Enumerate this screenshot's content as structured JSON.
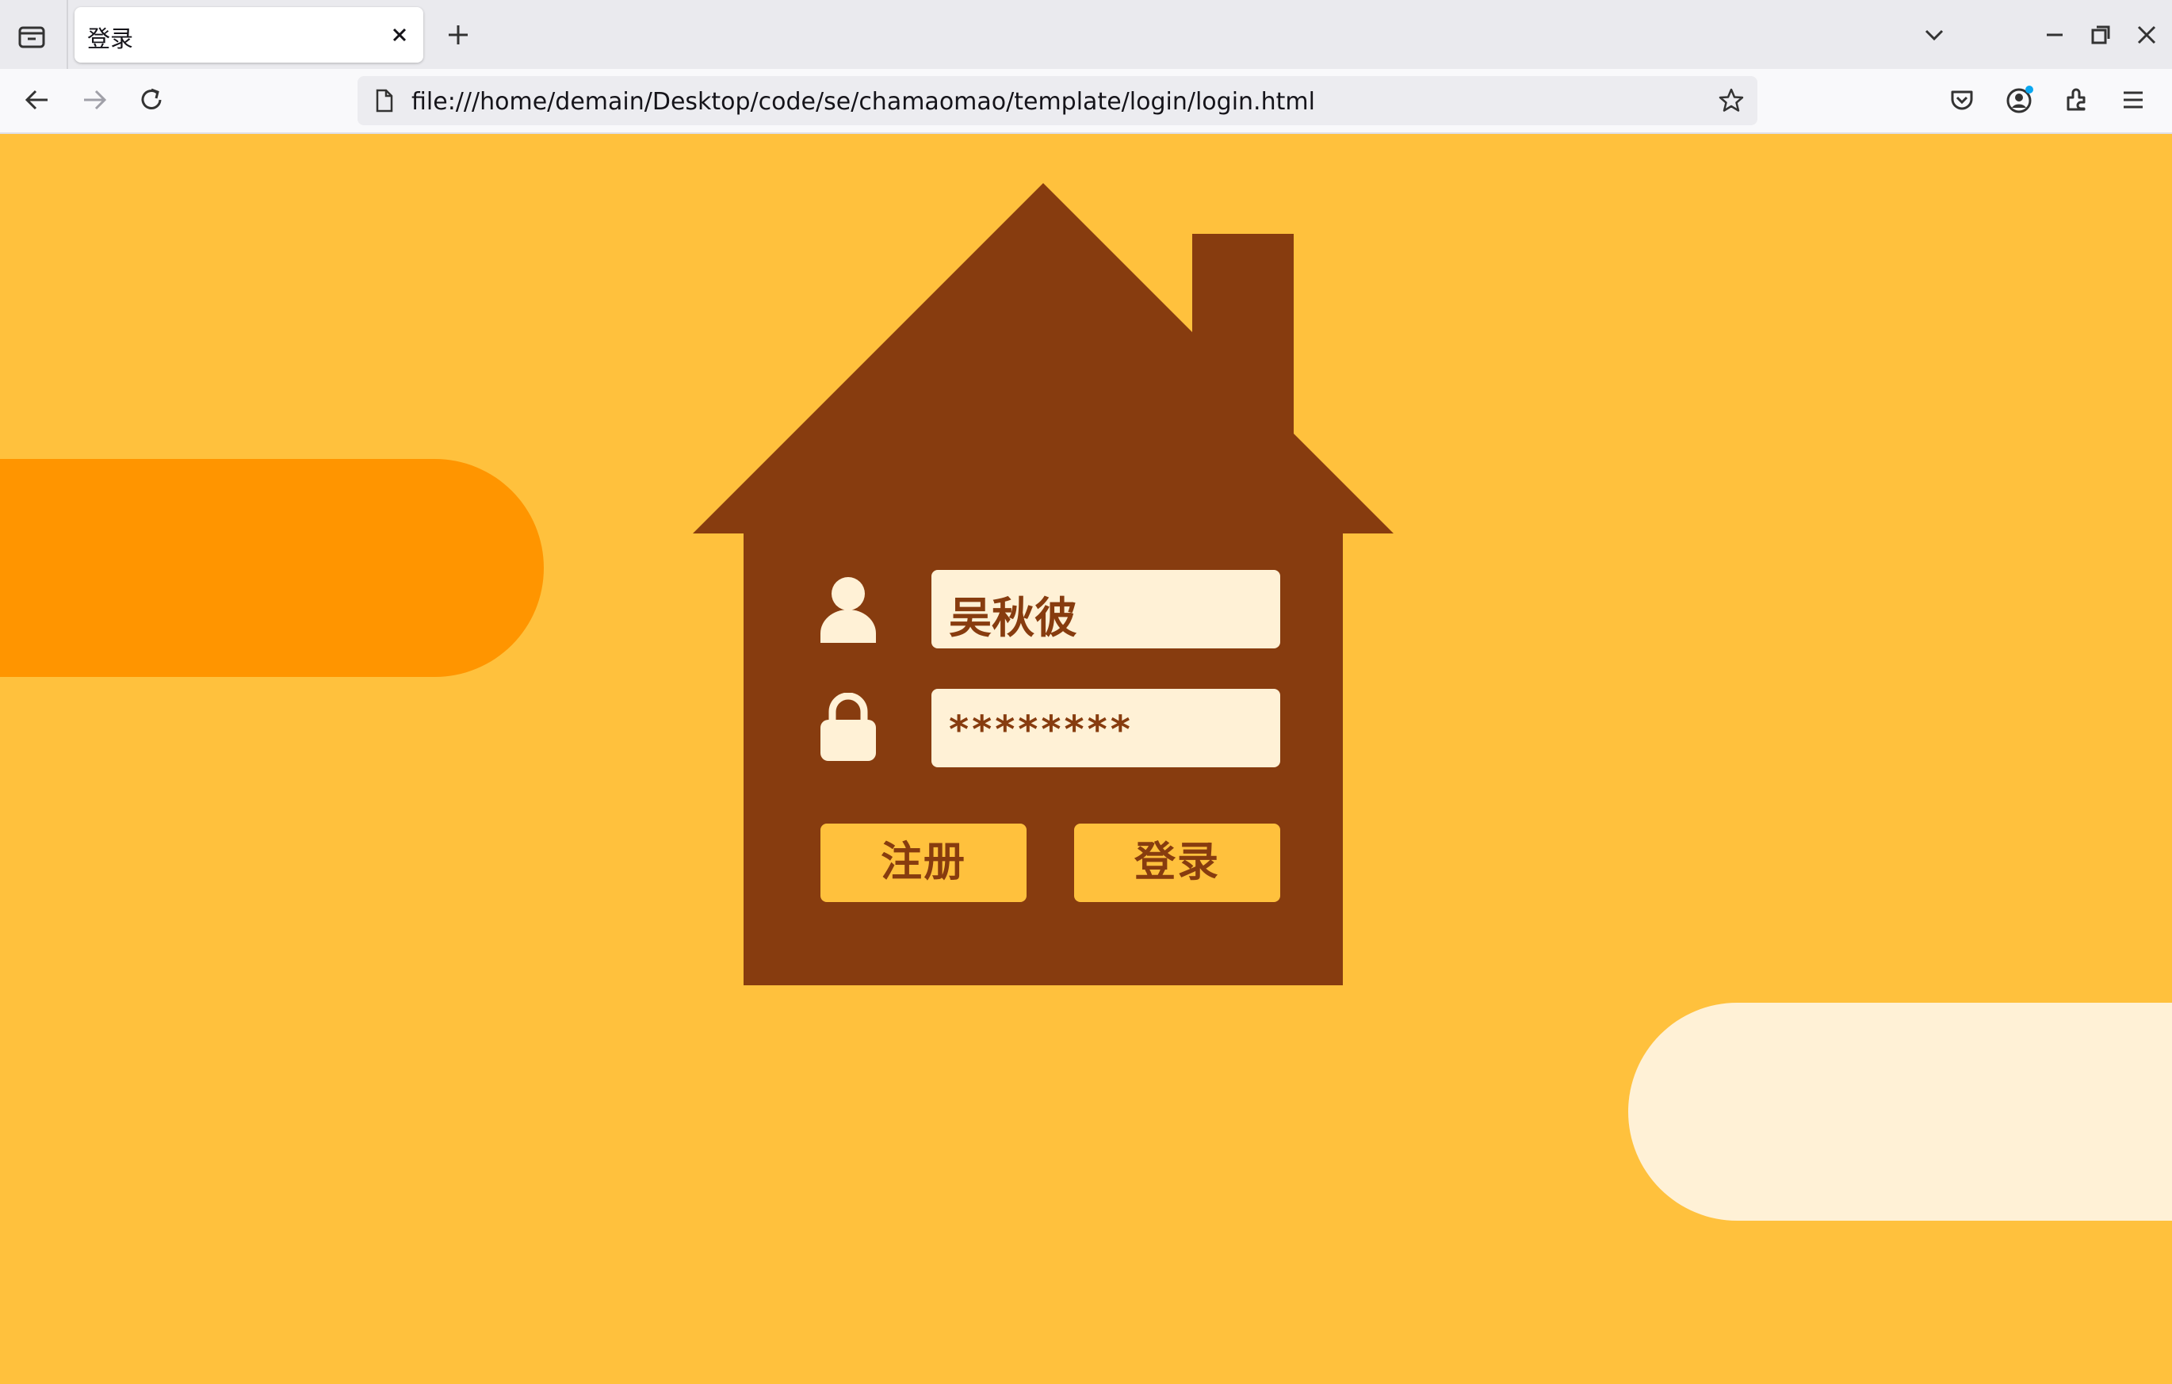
{
  "browser": {
    "tab_title": "登录",
    "url": "file:///home/demain/Desktop/code/se/chamaomao/template/login/login.html"
  },
  "form": {
    "username_value": "吴秋彼",
    "password_value": "********",
    "register_label": "注册",
    "login_label": "登录"
  },
  "colors": {
    "background": "#ffc13d",
    "house": "#873c0f",
    "field": "#fff1d6",
    "orange_pill": "#ff9500",
    "cream_pill": "#fff1d6"
  },
  "icons": {
    "user_field": "user-icon",
    "password_field": "lock-icon"
  }
}
